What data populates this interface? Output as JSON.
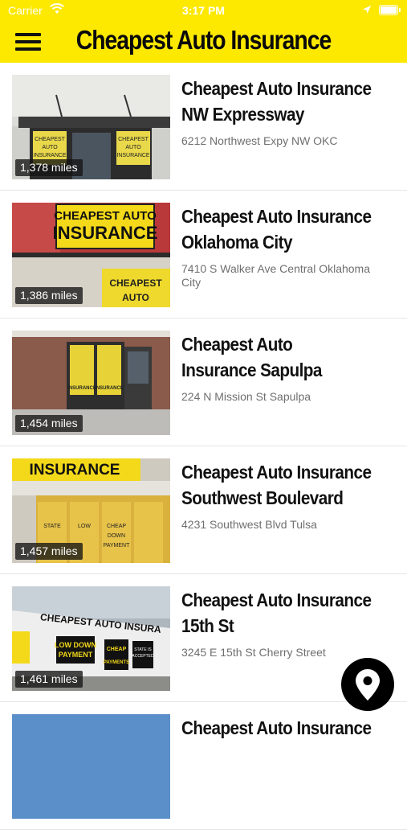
{
  "status_bar": {
    "carrier": "Carrier",
    "time": "3:17 PM"
  },
  "header": {
    "title": "Cheapest Auto Insurance",
    "menu_icon": "hamburger-menu-icon"
  },
  "locations": [
    {
      "title_line1": "Cheapest Auto Insurance",
      "title_line2": "NW Expressway",
      "address": "6212 Northwest Expy NW OKC",
      "distance": "1,378 miles"
    },
    {
      "title_line1": "Cheapest Auto Insurance",
      "title_line2": "Oklahoma City",
      "address": "7410 S Walker Ave Central Oklahoma City",
      "distance": "1,386 miles"
    },
    {
      "title_line1": "Cheapest Auto",
      "title_line2": "Insurance Sapulpa",
      "address": "224 N Mission St Sapulpa",
      "distance": "1,454 miles"
    },
    {
      "title_line1": "Cheapest Auto Insurance",
      "title_line2": "Southwest Boulevard",
      "address": "4231 Southwest Blvd Tulsa",
      "distance": "1,457 miles"
    },
    {
      "title_line1": "Cheapest Auto Insurance",
      "title_line2": "15th St",
      "address": "3245 E 15th St Cherry Street",
      "distance": "1,461 miles"
    },
    {
      "title_line1": "Cheapest Auto Insurance",
      "title_line2": "",
      "address": "",
      "distance": ""
    }
  ],
  "photo_text": {
    "photo1": [
      "CHEAPEST",
      "AUTO",
      "INSURANCE",
      "CHEAPEST",
      "AUTO",
      "INSURANCE"
    ],
    "photo2": [
      "CHEAPEST AUTO",
      "INSURANCE",
      "CHEAPEST",
      "AUTO"
    ],
    "photo3": [
      "INSURANCE",
      "INSURANCE"
    ],
    "photo4": [
      "INSURANCE",
      "STATE",
      "LOW",
      "CHEAP",
      "DOWN",
      "PAYMENT"
    ],
    "photo5": [
      "CHEAPEST AUTO INSURA",
      "LOW DOWN",
      "PAYMENT",
      "CHEAP",
      "PAYMENTS",
      "STATE IS",
      "ACCEPTED"
    ]
  },
  "map_button": {
    "icon": "map-pin-icon"
  },
  "colors": {
    "brand_yellow": "#fde800",
    "badge_bg": "#141414",
    "fab_bg": "#000000"
  }
}
